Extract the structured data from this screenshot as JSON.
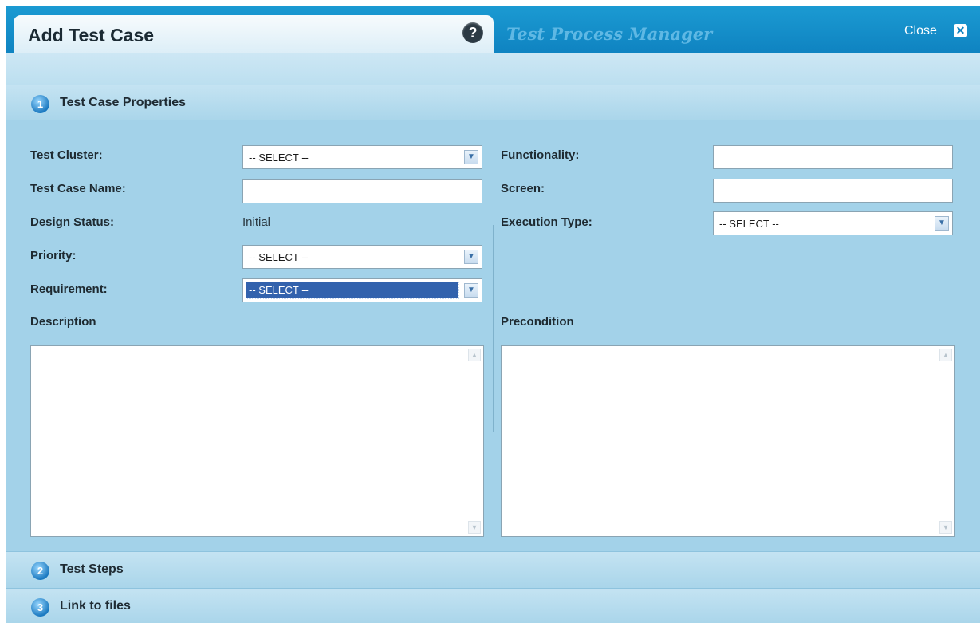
{
  "header": {
    "title": "Add Test Case",
    "app_title": "Test Process Manager",
    "close_label": "Close",
    "help_icon": "question-mark-icon",
    "close_icon": "close-x-icon"
  },
  "sections": [
    {
      "number": "1",
      "label": "Test Case Properties"
    },
    {
      "number": "2",
      "label": "Test Steps"
    },
    {
      "number": "3",
      "label": "Link to files"
    }
  ],
  "form": {
    "test_cluster": {
      "label": "Test Cluster:",
      "value": "-- SELECT --"
    },
    "test_case_name": {
      "label": "Test Case Name:",
      "value": ""
    },
    "design_status": {
      "label": "Design Status:",
      "value": "Initial"
    },
    "priority": {
      "label": "Priority:",
      "value": "-- SELECT --"
    },
    "requirement": {
      "label": "Requirement:",
      "value": "-- SELECT --"
    },
    "description": {
      "label": "Description",
      "value": ""
    },
    "functionality": {
      "label": "Functionality:",
      "value": ""
    },
    "screen": {
      "label": "Screen:",
      "value": ""
    },
    "execution_type": {
      "label": "Execution Type:",
      "value": "-- SELECT --"
    },
    "precondition": {
      "label": "Precondition",
      "value": ""
    }
  },
  "colors": {
    "header_blue": "#1b9ad2",
    "panel_blue": "#a3d2e9",
    "selection_blue": "#3262ad"
  }
}
